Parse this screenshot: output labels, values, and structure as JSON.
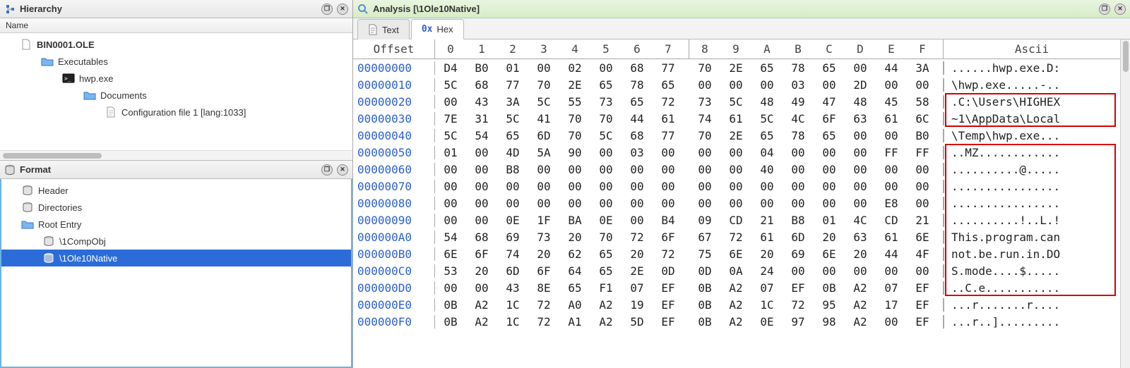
{
  "hierarchy": {
    "title": "Hierarchy",
    "name_header": "Name",
    "items": [
      {
        "label": "BIN0001.OLE",
        "icon": "file-icon",
        "indent": 1,
        "bold": true
      },
      {
        "label": "Executables",
        "icon": "folder-icon",
        "indent": 2
      },
      {
        "label": "hwp.exe",
        "icon": "exe-icon",
        "indent": 3
      },
      {
        "label": "Documents",
        "icon": "folder-icon",
        "indent": 4
      },
      {
        "label": "Configuration file 1 [lang:1033]",
        "icon": "doc-icon",
        "indent": 5
      }
    ]
  },
  "format": {
    "title": "Format",
    "items": [
      {
        "label": "Header",
        "icon": "db-icon",
        "indent": 1
      },
      {
        "label": "Directories",
        "icon": "db-icon",
        "indent": 1
      },
      {
        "label": "Root Entry",
        "icon": "folder-icon",
        "indent": 1
      },
      {
        "label": "\\1CompObj",
        "icon": "db-icon",
        "indent": 2
      },
      {
        "label": "\\1Ole10Native",
        "icon": "db-icon",
        "indent": 2,
        "selected": true
      }
    ]
  },
  "analysis": {
    "title": "Analysis [\\1Ole10Native]",
    "tabs": [
      {
        "label": "Text",
        "icon": "doc-icon",
        "active": false
      },
      {
        "label": "Hex",
        "icon": "ox-icon",
        "active": true
      }
    ]
  },
  "hex": {
    "header": {
      "offset": "Offset",
      "cols": [
        "0",
        "1",
        "2",
        "3",
        "4",
        "5",
        "6",
        "7",
        "8",
        "9",
        "A",
        "B",
        "C",
        "D",
        "E",
        "F"
      ],
      "ascii": "Ascii"
    },
    "rows": [
      {
        "offset": "00000000",
        "b": [
          "D4",
          "B0",
          "01",
          "00",
          "02",
          "00",
          "68",
          "77",
          "70",
          "2E",
          "65",
          "78",
          "65",
          "00",
          "44",
          "3A"
        ],
        "a": "......hwp.exe.D:"
      },
      {
        "offset": "00000010",
        "b": [
          "5C",
          "68",
          "77",
          "70",
          "2E",
          "65",
          "78",
          "65",
          "00",
          "00",
          "00",
          "03",
          "00",
          "2D",
          "00",
          "00"
        ],
        "a": "\\hwp.exe.....-.."
      },
      {
        "offset": "00000020",
        "b": [
          "00",
          "43",
          "3A",
          "5C",
          "55",
          "73",
          "65",
          "72",
          "73",
          "5C",
          "48",
          "49",
          "47",
          "48",
          "45",
          "58"
        ],
        "a": ".C:\\Users\\HIGHEX"
      },
      {
        "offset": "00000030",
        "b": [
          "7E",
          "31",
          "5C",
          "41",
          "70",
          "70",
          "44",
          "61",
          "74",
          "61",
          "5C",
          "4C",
          "6F",
          "63",
          "61",
          "6C"
        ],
        "a": "~1\\AppData\\Local"
      },
      {
        "offset": "00000040",
        "b": [
          "5C",
          "54",
          "65",
          "6D",
          "70",
          "5C",
          "68",
          "77",
          "70",
          "2E",
          "65",
          "78",
          "65",
          "00",
          "00",
          "B0"
        ],
        "a": "\\Temp\\hwp.exe..."
      },
      {
        "offset": "00000050",
        "b": [
          "01",
          "00",
          "4D",
          "5A",
          "90",
          "00",
          "03",
          "00",
          "00",
          "00",
          "04",
          "00",
          "00",
          "00",
          "FF",
          "FF"
        ],
        "a": "..MZ............"
      },
      {
        "offset": "00000060",
        "b": [
          "00",
          "00",
          "B8",
          "00",
          "00",
          "00",
          "00",
          "00",
          "00",
          "00",
          "40",
          "00",
          "00",
          "00",
          "00",
          "00"
        ],
        "a": "..........@....."
      },
      {
        "offset": "00000070",
        "b": [
          "00",
          "00",
          "00",
          "00",
          "00",
          "00",
          "00",
          "00",
          "00",
          "00",
          "00",
          "00",
          "00",
          "00",
          "00",
          "00"
        ],
        "a": "................"
      },
      {
        "offset": "00000080",
        "b": [
          "00",
          "00",
          "00",
          "00",
          "00",
          "00",
          "00",
          "00",
          "00",
          "00",
          "00",
          "00",
          "00",
          "00",
          "E8",
          "00"
        ],
        "a": "................"
      },
      {
        "offset": "00000090",
        "b": [
          "00",
          "00",
          "0E",
          "1F",
          "BA",
          "0E",
          "00",
          "B4",
          "09",
          "CD",
          "21",
          "B8",
          "01",
          "4C",
          "CD",
          "21"
        ],
        "a": "..........!..L.!"
      },
      {
        "offset": "000000A0",
        "b": [
          "54",
          "68",
          "69",
          "73",
          "20",
          "70",
          "72",
          "6F",
          "67",
          "72",
          "61",
          "6D",
          "20",
          "63",
          "61",
          "6E"
        ],
        "a": "This.program.can"
      },
      {
        "offset": "000000B0",
        "b": [
          "6E",
          "6F",
          "74",
          "20",
          "62",
          "65",
          "20",
          "72",
          "75",
          "6E",
          "20",
          "69",
          "6E",
          "20",
          "44",
          "4F"
        ],
        "a": "not.be.run.in.DO"
      },
      {
        "offset": "000000C0",
        "b": [
          "53",
          "20",
          "6D",
          "6F",
          "64",
          "65",
          "2E",
          "0D",
          "0D",
          "0A",
          "24",
          "00",
          "00",
          "00",
          "00",
          "00"
        ],
        "a": "S.mode....$....."
      },
      {
        "offset": "000000D0",
        "b": [
          "00",
          "00",
          "43",
          "8E",
          "65",
          "F1",
          "07",
          "EF",
          "0B",
          "A2",
          "07",
          "EF",
          "0B",
          "A2",
          "07",
          "EF"
        ],
        "a": "..C.e..........."
      },
      {
        "offset": "000000E0",
        "b": [
          "0B",
          "A2",
          "1C",
          "72",
          "A0",
          "A2",
          "19",
          "EF",
          "0B",
          "A2",
          "1C",
          "72",
          "95",
          "A2",
          "17",
          "EF"
        ],
        "a": "...r.......r...."
      },
      {
        "offset": "000000F0",
        "b": [
          "0B",
          "A2",
          "1C",
          "72",
          "A1",
          "A2",
          "5D",
          "EF",
          "0B",
          "A2",
          "0E",
          "97",
          "98",
          "A2",
          "00",
          "EF"
        ],
        "a": "...r..]........."
      }
    ],
    "highlights": {
      "box1_rows": [
        2,
        3
      ],
      "box2_rows": [
        5,
        6,
        7,
        8,
        9,
        10,
        11,
        12,
        13
      ]
    }
  }
}
